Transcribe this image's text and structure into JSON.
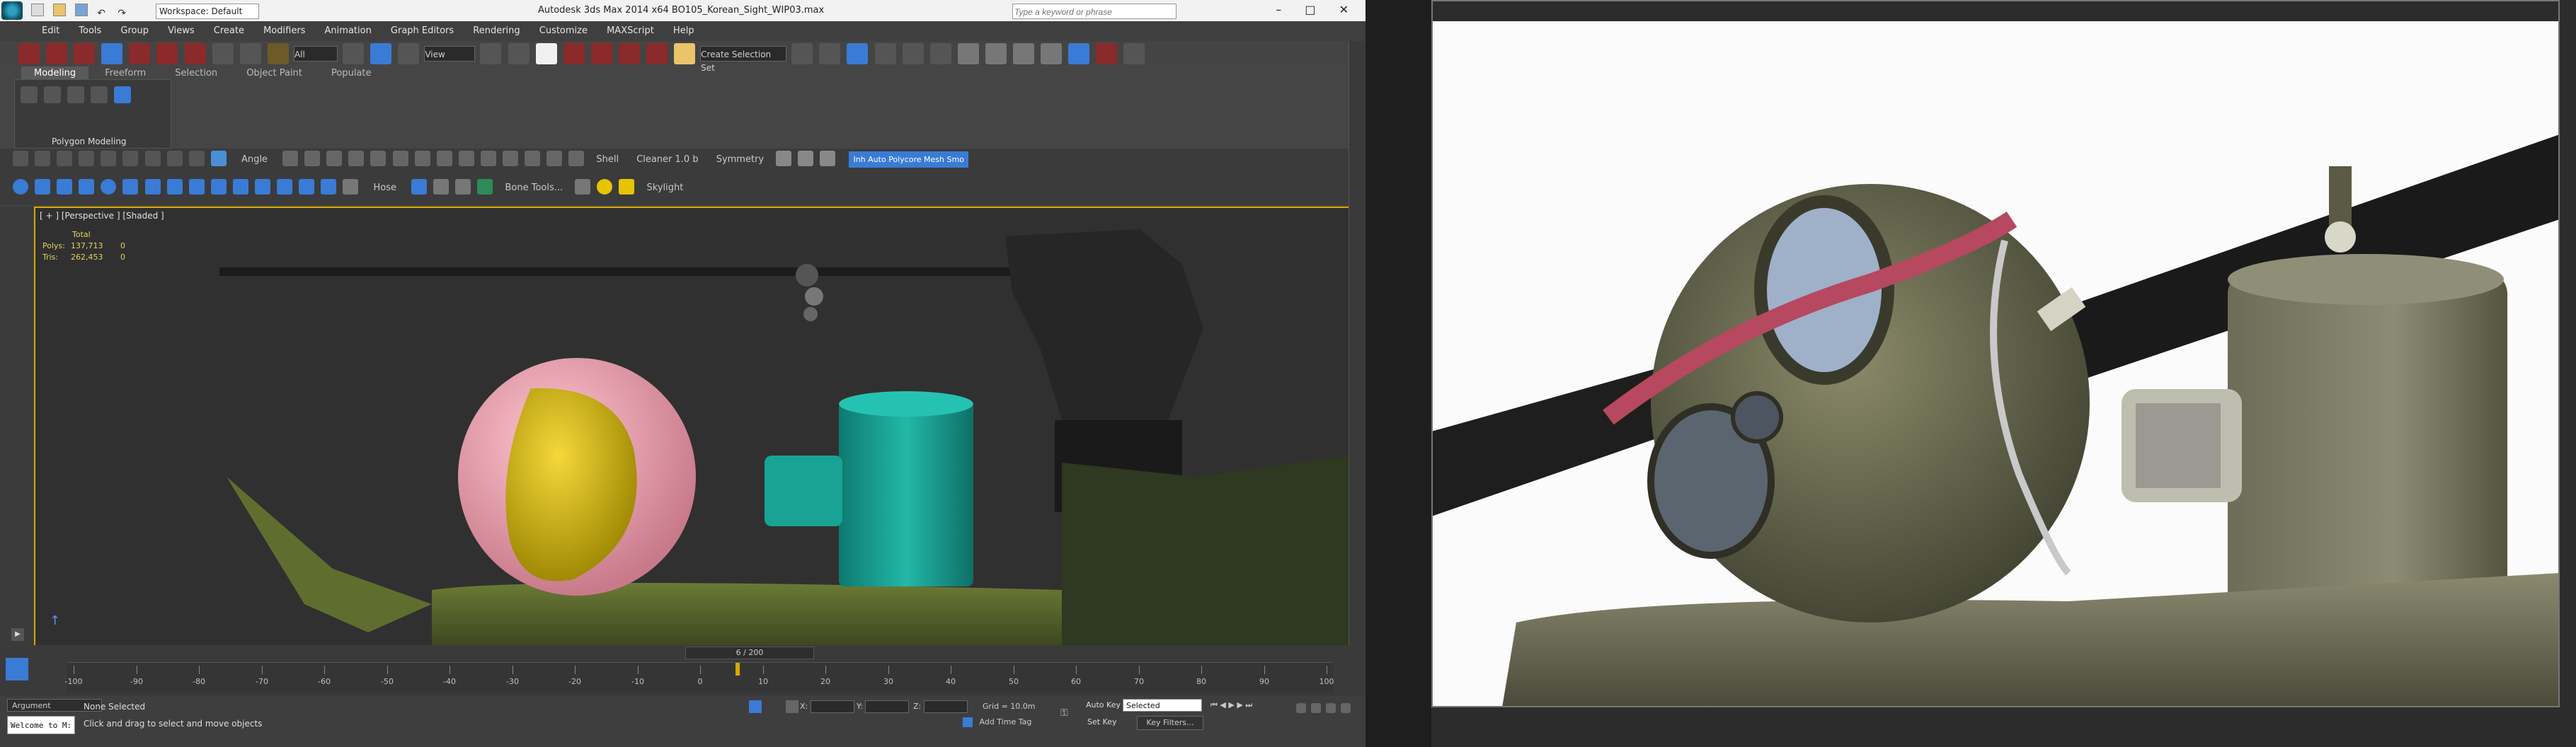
{
  "titlebar": {
    "workspace": "Workspace: Default",
    "title": "Autodesk 3ds Max  2014 x64     BO105_Korean_Sight_WIP03.max",
    "search_placeholder": "Type a keyword or phrase"
  },
  "menu": [
    "Edit",
    "Tools",
    "Group",
    "Views",
    "Create",
    "Modifiers",
    "Animation",
    "Graph Editors",
    "Rendering",
    "Customize",
    "MAXScript",
    "Help"
  ],
  "toolbar": {
    "filter": "All",
    "refcoord": "View",
    "selection_set": "Create Selection Set"
  },
  "ribbon": {
    "tabs": [
      "Modeling",
      "Freeform",
      "Selection",
      "Object Paint",
      "Populate"
    ],
    "panel_label": "Polygon Modeling",
    "angle_label": "Angle",
    "shell_label": "Shell",
    "cleaner_label": "Cleaner 1.0 b",
    "symmetry_label": "Symmetry",
    "hose_label": "Hose",
    "bone_label": "Bone Tools...",
    "skylight_label": "Skylight",
    "highlight_label": "Inh Auto Polycore Mesh Smo"
  },
  "viewport": {
    "label": "[ + ] [Perspective ] [Shaded ]",
    "stats_header": "Total",
    "polys_label": "Polys:",
    "polys_value": "137,713",
    "polys_sel": "0",
    "tris_label": "Tris:",
    "tris_value": "262,453",
    "tris_sel": "0"
  },
  "timeline": {
    "frame": "6 / 200",
    "ticks": [
      "-100",
      "-90",
      "-80",
      "-70",
      "-60",
      "-50",
      "-40",
      "-30",
      "-20",
      "-10",
      "0",
      "10",
      "20",
      "30",
      "40",
      "50",
      "60",
      "70",
      "80",
      "90",
      "100"
    ]
  },
  "status": {
    "argument": "Argument",
    "listener": "Welcome to M:",
    "selection": "None Selected",
    "prompt": "Click and drag to select and move objects",
    "x_label": "X:",
    "y_label": "Y:",
    "z_label": "Z:",
    "grid": "Grid = 10.0m",
    "add_time_tag": "Add Time Tag",
    "auto_key": "Auto Key",
    "auto_key_mode": "Selected",
    "set_key": "Set Key",
    "key_filters": "Key Filters..."
  },
  "colors": {
    "accent": "#d9a800",
    "highlight_blue": "#3a7bd5",
    "sphere_pink": "#f0a0b0",
    "sphere_yellow": "#e6c400",
    "cylinder_teal": "#1aa89a",
    "body_green": "#5a6b2a"
  }
}
